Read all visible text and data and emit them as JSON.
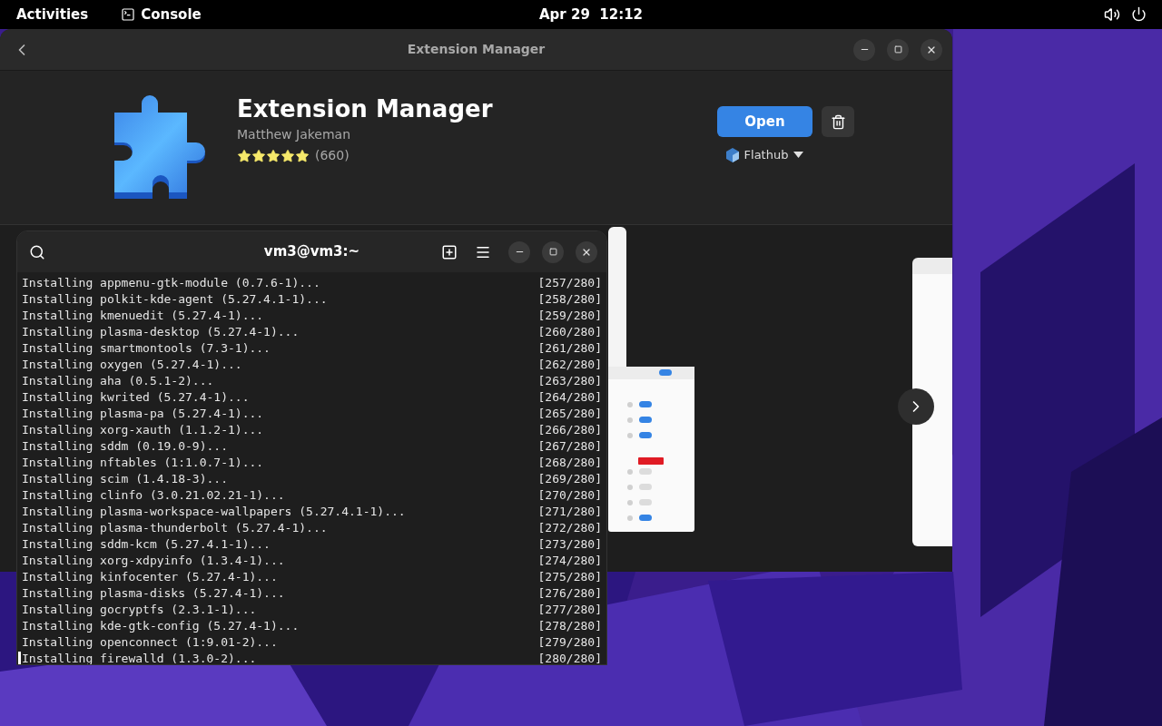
{
  "top_bar": {
    "activities": "Activities",
    "app": "Console",
    "clock": "Apr 29  12:12"
  },
  "software_window": {
    "title": "Extension Manager",
    "app": {
      "name": "Extension Manager",
      "developer": "Matthew Jakeman",
      "stars": 5,
      "rating_count": "(660)",
      "open_button": "Open",
      "source": "Flathub"
    }
  },
  "terminal": {
    "title": "vm3@vm3:~",
    "lines": [
      {
        "text": "Installing appmenu-gtk-module (0.7.6-1)...",
        "progress": "[257/280]"
      },
      {
        "text": "Installing polkit-kde-agent (5.27.4.1-1)...",
        "progress": "[258/280]"
      },
      {
        "text": "Installing kmenuedit (5.27.4-1)...",
        "progress": "[259/280]"
      },
      {
        "text": "Installing plasma-desktop (5.27.4-1)...",
        "progress": "[260/280]"
      },
      {
        "text": "Installing smartmontools (7.3-1)...",
        "progress": "[261/280]"
      },
      {
        "text": "Installing oxygen (5.27.4-1)...",
        "progress": "[262/280]"
      },
      {
        "text": "Installing aha (0.5.1-2)...",
        "progress": "[263/280]"
      },
      {
        "text": "Installing kwrited (5.27.4-1)...",
        "progress": "[264/280]"
      },
      {
        "text": "Installing plasma-pa (5.27.4-1)...",
        "progress": "[265/280]"
      },
      {
        "text": "Installing xorg-xauth (1.1.2-1)...",
        "progress": "[266/280]"
      },
      {
        "text": "Installing sddm (0.19.0-9)...",
        "progress": "[267/280]"
      },
      {
        "text": "Installing nftables (1:1.0.7-1)...",
        "progress": "[268/280]"
      },
      {
        "text": "Installing scim (1.4.18-3)...",
        "progress": "[269/280]"
      },
      {
        "text": "Installing clinfo (3.0.21.02.21-1)...",
        "progress": "[270/280]"
      },
      {
        "text": "Installing plasma-workspace-wallpapers (5.27.4.1-1)...",
        "progress": "[271/280]"
      },
      {
        "text": "Installing plasma-thunderbolt (5.27.4-1)...",
        "progress": "[272/280]"
      },
      {
        "text": "Installing sddm-kcm (5.27.4.1-1)...",
        "progress": "[273/280]"
      },
      {
        "text": "Installing xorg-xdpyinfo (1.3.4-1)...",
        "progress": "[274/280]"
      },
      {
        "text": "Installing kinfocenter (5.27.4-1)...",
        "progress": "[275/280]"
      },
      {
        "text": "Installing plasma-disks (5.27.4-1)...",
        "progress": "[276/280]"
      },
      {
        "text": "Installing gocryptfs (2.3.1-1)...",
        "progress": "[277/280]"
      },
      {
        "text": "Installing kde-gtk-config (5.27.4-1)...",
        "progress": "[278/280]"
      },
      {
        "text": "Installing openconnect (1:9.01-2)...",
        "progress": "[279/280]"
      },
      {
        "text": "Installing firewalld (1.3.0-2)...",
        "progress": "[280/280]"
      }
    ]
  }
}
